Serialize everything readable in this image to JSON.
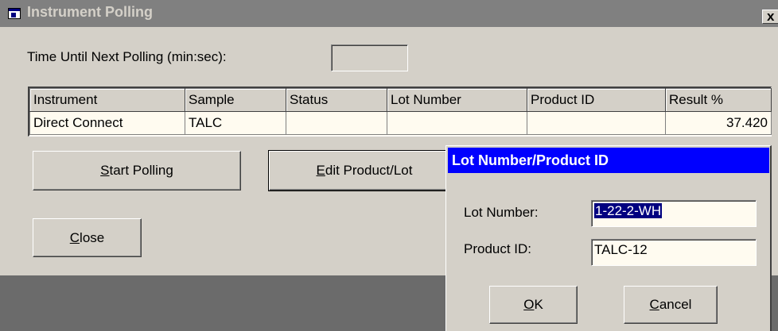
{
  "window": {
    "title": "Instrument Polling",
    "close_glyph": "x"
  },
  "polling": {
    "label": "Time Until Next Polling (min:sec):",
    "value": ""
  },
  "table": {
    "columns": [
      "Instrument",
      "Sample",
      "Status",
      "Lot Number",
      "Product ID",
      "Result %"
    ],
    "rows": [
      [
        "Direct Connect",
        "TALC",
        "",
        "",
        "",
        "37.420"
      ]
    ]
  },
  "buttons": {
    "start_polling": {
      "access_key": "S",
      "rest": "tart Polling"
    },
    "edit_product_lot": {
      "access_key": "E",
      "rest": "dit Product/Lot"
    },
    "close": {
      "access_key": "C",
      "rest": "lose"
    }
  },
  "dialog": {
    "title": "Lot Number/Product ID",
    "lot_label": "Lot Number:",
    "lot_value": "1-22-2-WH",
    "product_label": "Product ID:",
    "product_value": "TALC-12",
    "ok": {
      "access_key": "O",
      "rest": "K"
    },
    "cancel": {
      "access_key": "C",
      "rest": "ancel"
    }
  },
  "colors": {
    "face": "#d4d0c8",
    "inactive_title": "#808080",
    "active_title": "#0000ff",
    "field_bg": "#fffbf0",
    "desktop": "#6b6b6b"
  },
  "icons": {
    "window_icon": "app-window-icon",
    "close": "close-icon"
  }
}
